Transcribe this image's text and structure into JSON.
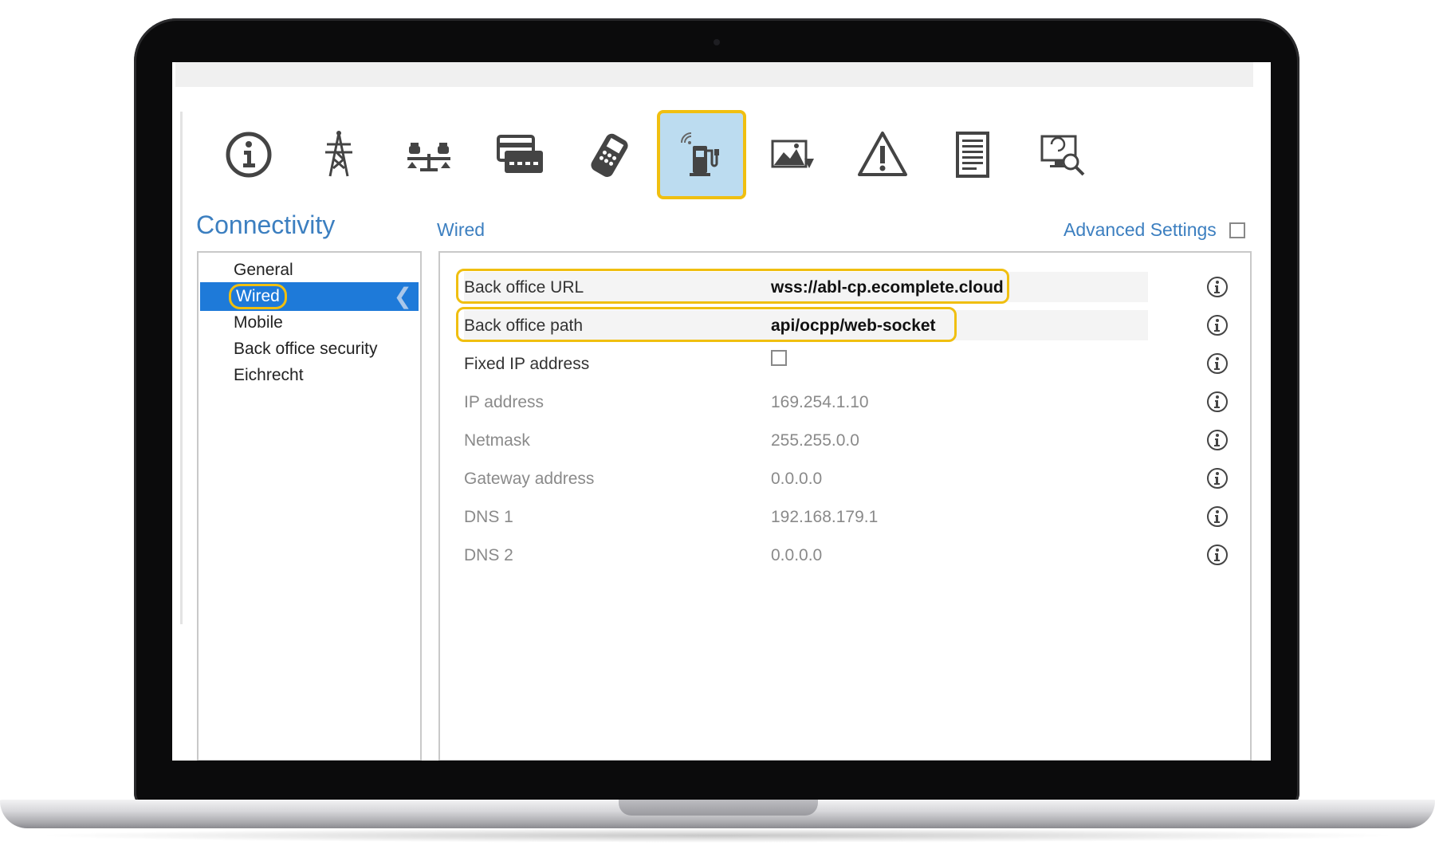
{
  "toolbar": {
    "icons": [
      "info-icon",
      "power-pylon-icon",
      "load-balance-icon",
      "card-reader-icon",
      "payment-terminal-icon",
      "charging-station-icon",
      "image-arrow-icon",
      "warning-icon",
      "document-icon",
      "monitor-search-icon"
    ],
    "active_icon": "charging-station-icon"
  },
  "page": {
    "title": "Connectivity"
  },
  "sidebar": {
    "items": [
      {
        "label": "General"
      },
      {
        "label": "Wired",
        "active": true
      },
      {
        "label": "Mobile"
      },
      {
        "label": "Back office security"
      },
      {
        "label": "Eichrecht"
      }
    ]
  },
  "section": {
    "title": "Wired",
    "advanced_label": "Advanced Settings",
    "advanced_checked": false
  },
  "settings": {
    "back_office_url": {
      "label": "Back office URL",
      "value": "wss://abl-cp.ecomplete.cloud"
    },
    "back_office_path": {
      "label": "Back office path",
      "value": "api/ocpp/web-socket"
    },
    "fixed_ip": {
      "label": "Fixed IP address",
      "checked": false
    },
    "ip_address": {
      "label": "IP address",
      "value": "169.254.1.10"
    },
    "netmask": {
      "label": "Netmask",
      "value": "255.255.0.0"
    },
    "gateway": {
      "label": "Gateway address",
      "value": "0.0.0.0"
    },
    "dns1": {
      "label": "DNS 1",
      "value": "192.168.179.1"
    },
    "dns2": {
      "label": "DNS 2",
      "value": "0.0.0.0"
    }
  },
  "colors": {
    "accent_blue": "#3c7fc0",
    "selection_blue": "#1e7ad9",
    "highlight_yellow": "#f0bf10",
    "active_tab_bg": "#bcdcf0"
  }
}
